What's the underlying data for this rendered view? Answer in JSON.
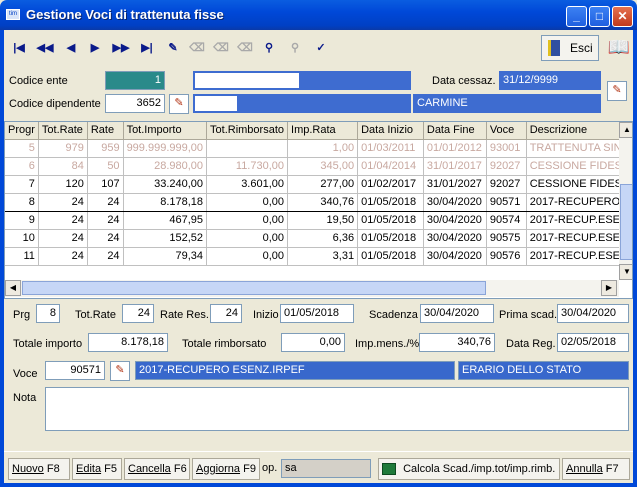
{
  "window": {
    "app_icon": "tim",
    "title": "Gestione Voci di trattenuta fisse",
    "controls": {
      "minimize": "_",
      "maximize": "□",
      "close": "✕"
    }
  },
  "toolbar": {
    "nav": [
      "|◀",
      "◀◀",
      "◀",
      "▶",
      "▶▶",
      "▶|"
    ],
    "tools": [
      "✎",
      "⌫",
      "⌫",
      "⌫",
      "⚲",
      "⚲",
      "✓"
    ],
    "exit_label": "Esci",
    "help_glyph": "📖"
  },
  "header": {
    "ente_label": "Codice ente",
    "ente_value": "1",
    "dipendente_label": "Codice dipendente",
    "dipendente_value": "3652",
    "cessaz_label": "Data cessaz.",
    "cessaz_value": "31/12/9999",
    "nome": "CARMINE"
  },
  "grid": {
    "columns": [
      "Progr",
      "Tot.Rate",
      "Rate",
      "Tot.Importo",
      "Tot.Rimborsato",
      "Imp.Rata",
      "Data Inizio",
      "Data Fine",
      "Voce",
      "Descrizione"
    ],
    "rows": [
      {
        "progr": "5",
        "tot_rate": "979",
        "rate": "959",
        "tot_importo": "999.999.999,00",
        "tot_rimb": "",
        "imp_rata": "1,00",
        "inizio": "01/03/2011",
        "fine": "01/01/2012",
        "voce": "93001",
        "desc": "TRATTENUTA SIN"
      },
      {
        "progr": "6",
        "tot_rate": "84",
        "rate": "50",
        "tot_importo": "28.980,00",
        "tot_rimb": "11.730,00",
        "imp_rata": "345,00",
        "inizio": "01/04/2014",
        "fine": "31/01/2017",
        "voce": "92027",
        "desc": "CESSIONE FIDES"
      },
      {
        "progr": "7",
        "tot_rate": "120",
        "rate": "107",
        "tot_importo": "33.240,00",
        "tot_rimb": "3.601,00",
        "imp_rata": "277,00",
        "inizio": "01/02/2017",
        "fine": "31/01/2027",
        "voce": "92027",
        "desc": "CESSIONE FIDES"
      },
      {
        "progr": "8",
        "tot_rate": "24",
        "rate": "24",
        "tot_importo": "8.178,18",
        "tot_rimb": "0,00",
        "imp_rata": "340,76",
        "inizio": "01/05/2018",
        "fine": "30/04/2020",
        "voce": "90571",
        "desc": "2017-RECUPERO"
      },
      {
        "progr": "9",
        "tot_rate": "24",
        "rate": "24",
        "tot_importo": "467,95",
        "tot_rimb": "0,00",
        "imp_rata": "19,50",
        "inizio": "01/05/2018",
        "fine": "30/04/2020",
        "voce": "90574",
        "desc": "2017-RECUP.ESEN"
      },
      {
        "progr": "10",
        "tot_rate": "24",
        "rate": "24",
        "tot_importo": "152,52",
        "tot_rimb": "0,00",
        "imp_rata": "6,36",
        "inizio": "01/05/2018",
        "fine": "30/04/2020",
        "voce": "90575",
        "desc": "2017-RECUP.ESEN"
      },
      {
        "progr": "11",
        "tot_rate": "24",
        "rate": "24",
        "tot_importo": "79,34",
        "tot_rimb": "0,00",
        "imp_rata": "3,31",
        "inizio": "01/05/2018",
        "fine": "30/04/2020",
        "voce": "90576",
        "desc": "2017-RECUP.ESEN"
      }
    ]
  },
  "detail": {
    "prg_label": "Prg",
    "prg_value": "8",
    "totrate_label": "Tot.Rate",
    "totrate_value": "24",
    "rateres_label": "Rate Res.",
    "rateres_value": "24",
    "inizio_label": "Inizio",
    "inizio_value": "01/05/2018",
    "scadenza_label": "Scadenza",
    "scadenza_value": "30/04/2020",
    "primascad_label": "Prima scad.",
    "primascad_value": "30/04/2020",
    "totimporto_label": "Totale importo",
    "totimporto_value": "8.178,18",
    "totrimb_label": "Totale rimborsato",
    "totrimb_value": "0,00",
    "impmens_label": "Imp.mens./%",
    "impmens_value": "340,76",
    "datareg_label": "Data Reg.",
    "datareg_value": "02/05/2018",
    "voce_label": "Voce",
    "voce_value": "90571",
    "voce_desc": "2017-RECUPERO ESENZ.IRPEF",
    "voce_ente": "ERARIO DELLO STATO",
    "nota_label": "Nota",
    "nota_value": ""
  },
  "footer": {
    "nuovo": "Nuovo",
    "nuovo_key": "F8",
    "edita": "Edita",
    "edita_key": "F5",
    "cancella": "Cancella",
    "cancella_key": "F6",
    "aggiorna": "Aggiorna",
    "aggiorna_key": "F9",
    "op_label": "op.",
    "op_value": "sa",
    "calcola": "Calcola Scad./imp.tot/imp.rimb.",
    "annulla": "Annulla",
    "annulla_key": "F7"
  }
}
